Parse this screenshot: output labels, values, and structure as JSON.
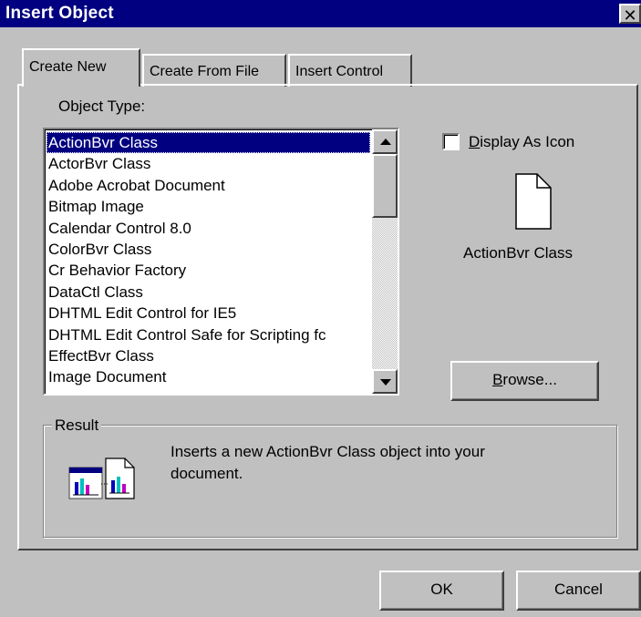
{
  "dialog": {
    "title": "Insert Object",
    "close_glyph": "✕"
  },
  "tabs": [
    {
      "label": "Create New",
      "active": true
    },
    {
      "label": "Create From File",
      "active": false
    },
    {
      "label": "Insert Control",
      "active": false
    }
  ],
  "object_type": {
    "label": "Object Type:",
    "items": [
      "ActionBvr Class",
      "ActorBvr Class",
      "Adobe Acrobat Document",
      "Bitmap Image",
      "Calendar Control 8.0",
      "ColorBvr Class",
      "Cr Behavior Factory",
      "DataCtl Class",
      "DHTML Edit Control for IE5",
      "DHTML Edit Control Safe for Scripting fc",
      "EffectBvr Class",
      "Image Document"
    ],
    "selected_index": 0
  },
  "display_as_icon": {
    "label_prefix": "",
    "label_accel": "D",
    "label_rest": "isplay As Icon",
    "checked": false,
    "icon_caption": "ActionBvr Class"
  },
  "browse_button": {
    "accel": "B",
    "rest": "rowse..."
  },
  "result": {
    "title": "Result",
    "text_line1": "Inserts a new ActionBvr Class object into your",
    "text_line2": "document."
  },
  "buttons": {
    "ok": "OK",
    "cancel": "Cancel"
  },
  "colors": {
    "titlebar": "#000080",
    "face": "#c0c0c0",
    "selection": "#000080"
  },
  "icons": [
    "close-icon",
    "document-icon",
    "result-objects-icon",
    "scroll-up-arrow-icon",
    "scroll-down-arrow-icon"
  ]
}
